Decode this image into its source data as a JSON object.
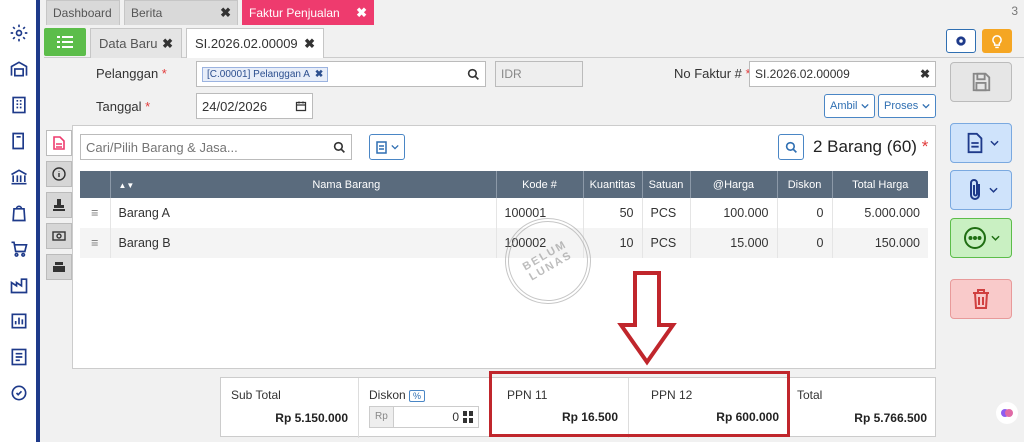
{
  "tabs": [
    {
      "label": "Dashboard",
      "closable": false
    },
    {
      "label": "Berita",
      "closable": true
    },
    {
      "label": "Faktur Penjualan",
      "closable": true
    }
  ],
  "tab_count": "3",
  "sub_tabs": [
    {
      "label": "Data Baru"
    },
    {
      "label": "SI.2026.02.00009"
    }
  ],
  "close_glyph": "✖",
  "form": {
    "pelanggan_label": "Pelanggan",
    "pelanggan_value": "[C.00001] Pelanggan A",
    "currency": "IDR",
    "tanggal_label": "Tanggal",
    "tanggal_value": "24/02/2026",
    "no_faktur_label": "No Faktur #",
    "no_faktur_value": "SI.2026.02.00009",
    "required_mark": "*",
    "ambil_label": "Ambil",
    "proses_label": "Proses"
  },
  "search": {
    "placeholder": "Cari/Pilih Barang & Jasa..."
  },
  "item_count": "2 Barang (60)",
  "table": {
    "headers": [
      "Nama Barang",
      "Kode #",
      "Kuantitas",
      "Satuan",
      "@Harga",
      "Diskon",
      "Total Harga"
    ],
    "rows": [
      {
        "nama": "Barang A",
        "kode": "100001",
        "qty": "50",
        "satuan": "PCS",
        "harga": "100.000",
        "diskon": "0",
        "total": "5.000.000"
      },
      {
        "nama": "Barang B",
        "kode": "100002",
        "qty": "10",
        "satuan": "PCS",
        "harga": "15.000",
        "diskon": "0",
        "total": "150.000"
      }
    ]
  },
  "stamp": {
    "line1": "BELUM",
    "line2": "LUNAS"
  },
  "summary": {
    "subtotal_label": "Sub Total",
    "subtotal_value": "Rp 5.150.000",
    "diskon_label": "Diskon",
    "diskon_badge": "%",
    "diskon_prefix": "Rp",
    "diskon_value": "0",
    "ppn11_label": "PPN 11",
    "ppn11_value": "Rp 16.500",
    "ppn12_label": "PPN 12",
    "ppn12_value": "Rp 600.000",
    "total_label": "Total",
    "total_value": "Rp 5.766.500"
  },
  "colors": {
    "accent_tab": "#ee3b6e",
    "nav_border": "#1e3a8a",
    "highlight_box": "#c0262c",
    "add_green": "#5cbd4a",
    "blue_btn": "#cfe3fb",
    "green_btn": "#c9f0c2",
    "red_btn": "#f9caca"
  }
}
